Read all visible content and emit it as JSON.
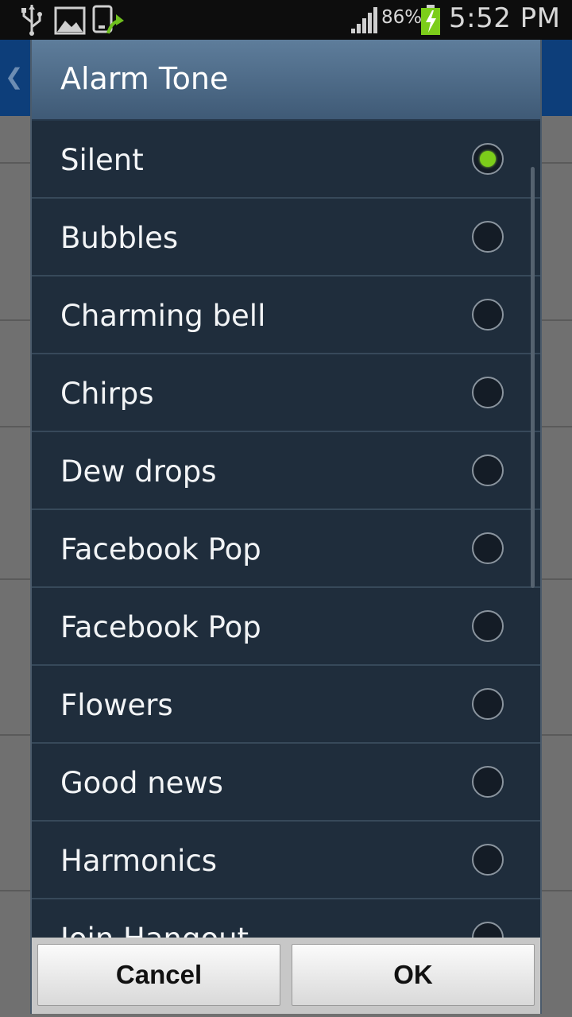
{
  "status_bar": {
    "battery_percent": "86%",
    "time": "5:52 PM",
    "icons": [
      "usb-icon",
      "gallery-icon",
      "sync-icon",
      "signal-icon",
      "battery-charging-icon"
    ]
  },
  "dialog": {
    "title": "Alarm Tone",
    "selected_index": 0,
    "accent_color": "#7ccd1a",
    "options": [
      {
        "label": "Silent",
        "selected": true
      },
      {
        "label": "Bubbles",
        "selected": false
      },
      {
        "label": "Charming bell",
        "selected": false
      },
      {
        "label": "Chirps",
        "selected": false
      },
      {
        "label": "Dew drops",
        "selected": false
      },
      {
        "label": "Facebook Pop",
        "selected": false
      },
      {
        "label": "Facebook Pop",
        "selected": false
      },
      {
        "label": "Flowers",
        "selected": false
      },
      {
        "label": "Good news",
        "selected": false
      },
      {
        "label": "Harmonics",
        "selected": false
      },
      {
        "label": "Join Hangout",
        "selected": false
      }
    ],
    "buttons": {
      "cancel": "Cancel",
      "ok": "OK"
    }
  }
}
